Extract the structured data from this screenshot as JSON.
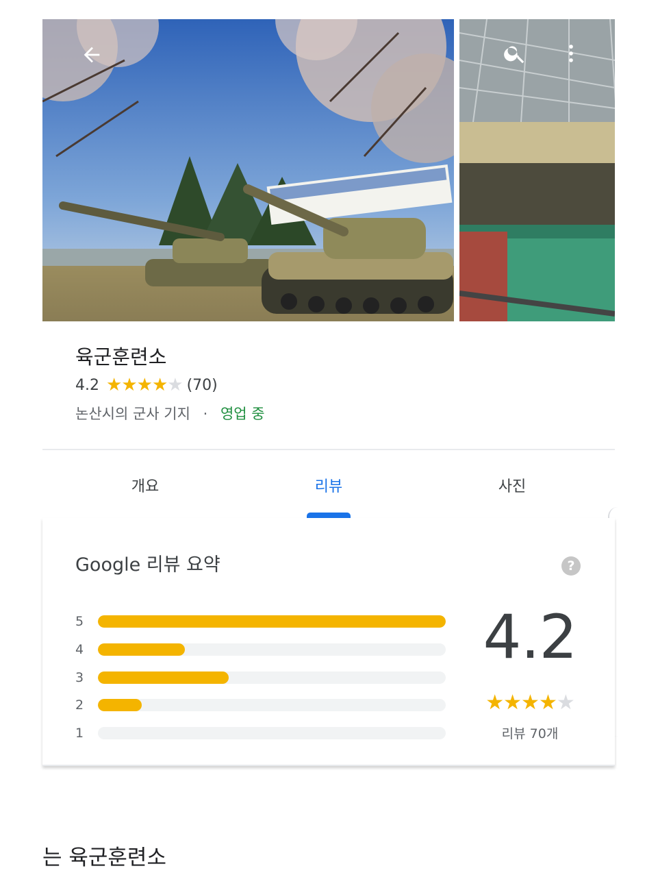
{
  "place": {
    "name": "육군훈련소",
    "rating": "4.2",
    "review_count_paren": "(70)",
    "category": "논산시의 군사 기지",
    "separator": "·",
    "status": "영업 중"
  },
  "tabs": [
    {
      "label": "개요",
      "active": false
    },
    {
      "label": "리뷰",
      "active": true
    },
    {
      "label": "사진",
      "active": false
    }
  ],
  "review_summary": {
    "title": "Google 리뷰 요약",
    "help_icon": "?",
    "bars": [
      {
        "stars": "5",
        "fraction": 1.0
      },
      {
        "stars": "4",
        "fraction": 0.25
      },
      {
        "stars": "3",
        "fraction": 0.375
      },
      {
        "stars": "2",
        "fraction": 0.125
      },
      {
        "stars": "1",
        "fraction": 0.0
      }
    ],
    "rating": "4.2",
    "stars_filled": 4,
    "stars_total": 5,
    "review_count_label": "리뷰 70개"
  },
  "footer": {
    "text": "는 육군훈련소"
  },
  "icons": {
    "back": "arrow-back-icon",
    "search": "search-icon",
    "more": "more-vert-icon",
    "help": "help-icon"
  },
  "colors": {
    "accent": "#1a73e8",
    "star": "#f4b400",
    "open_status": "#1e8e3e",
    "bar_track": "#f1f3f4"
  }
}
